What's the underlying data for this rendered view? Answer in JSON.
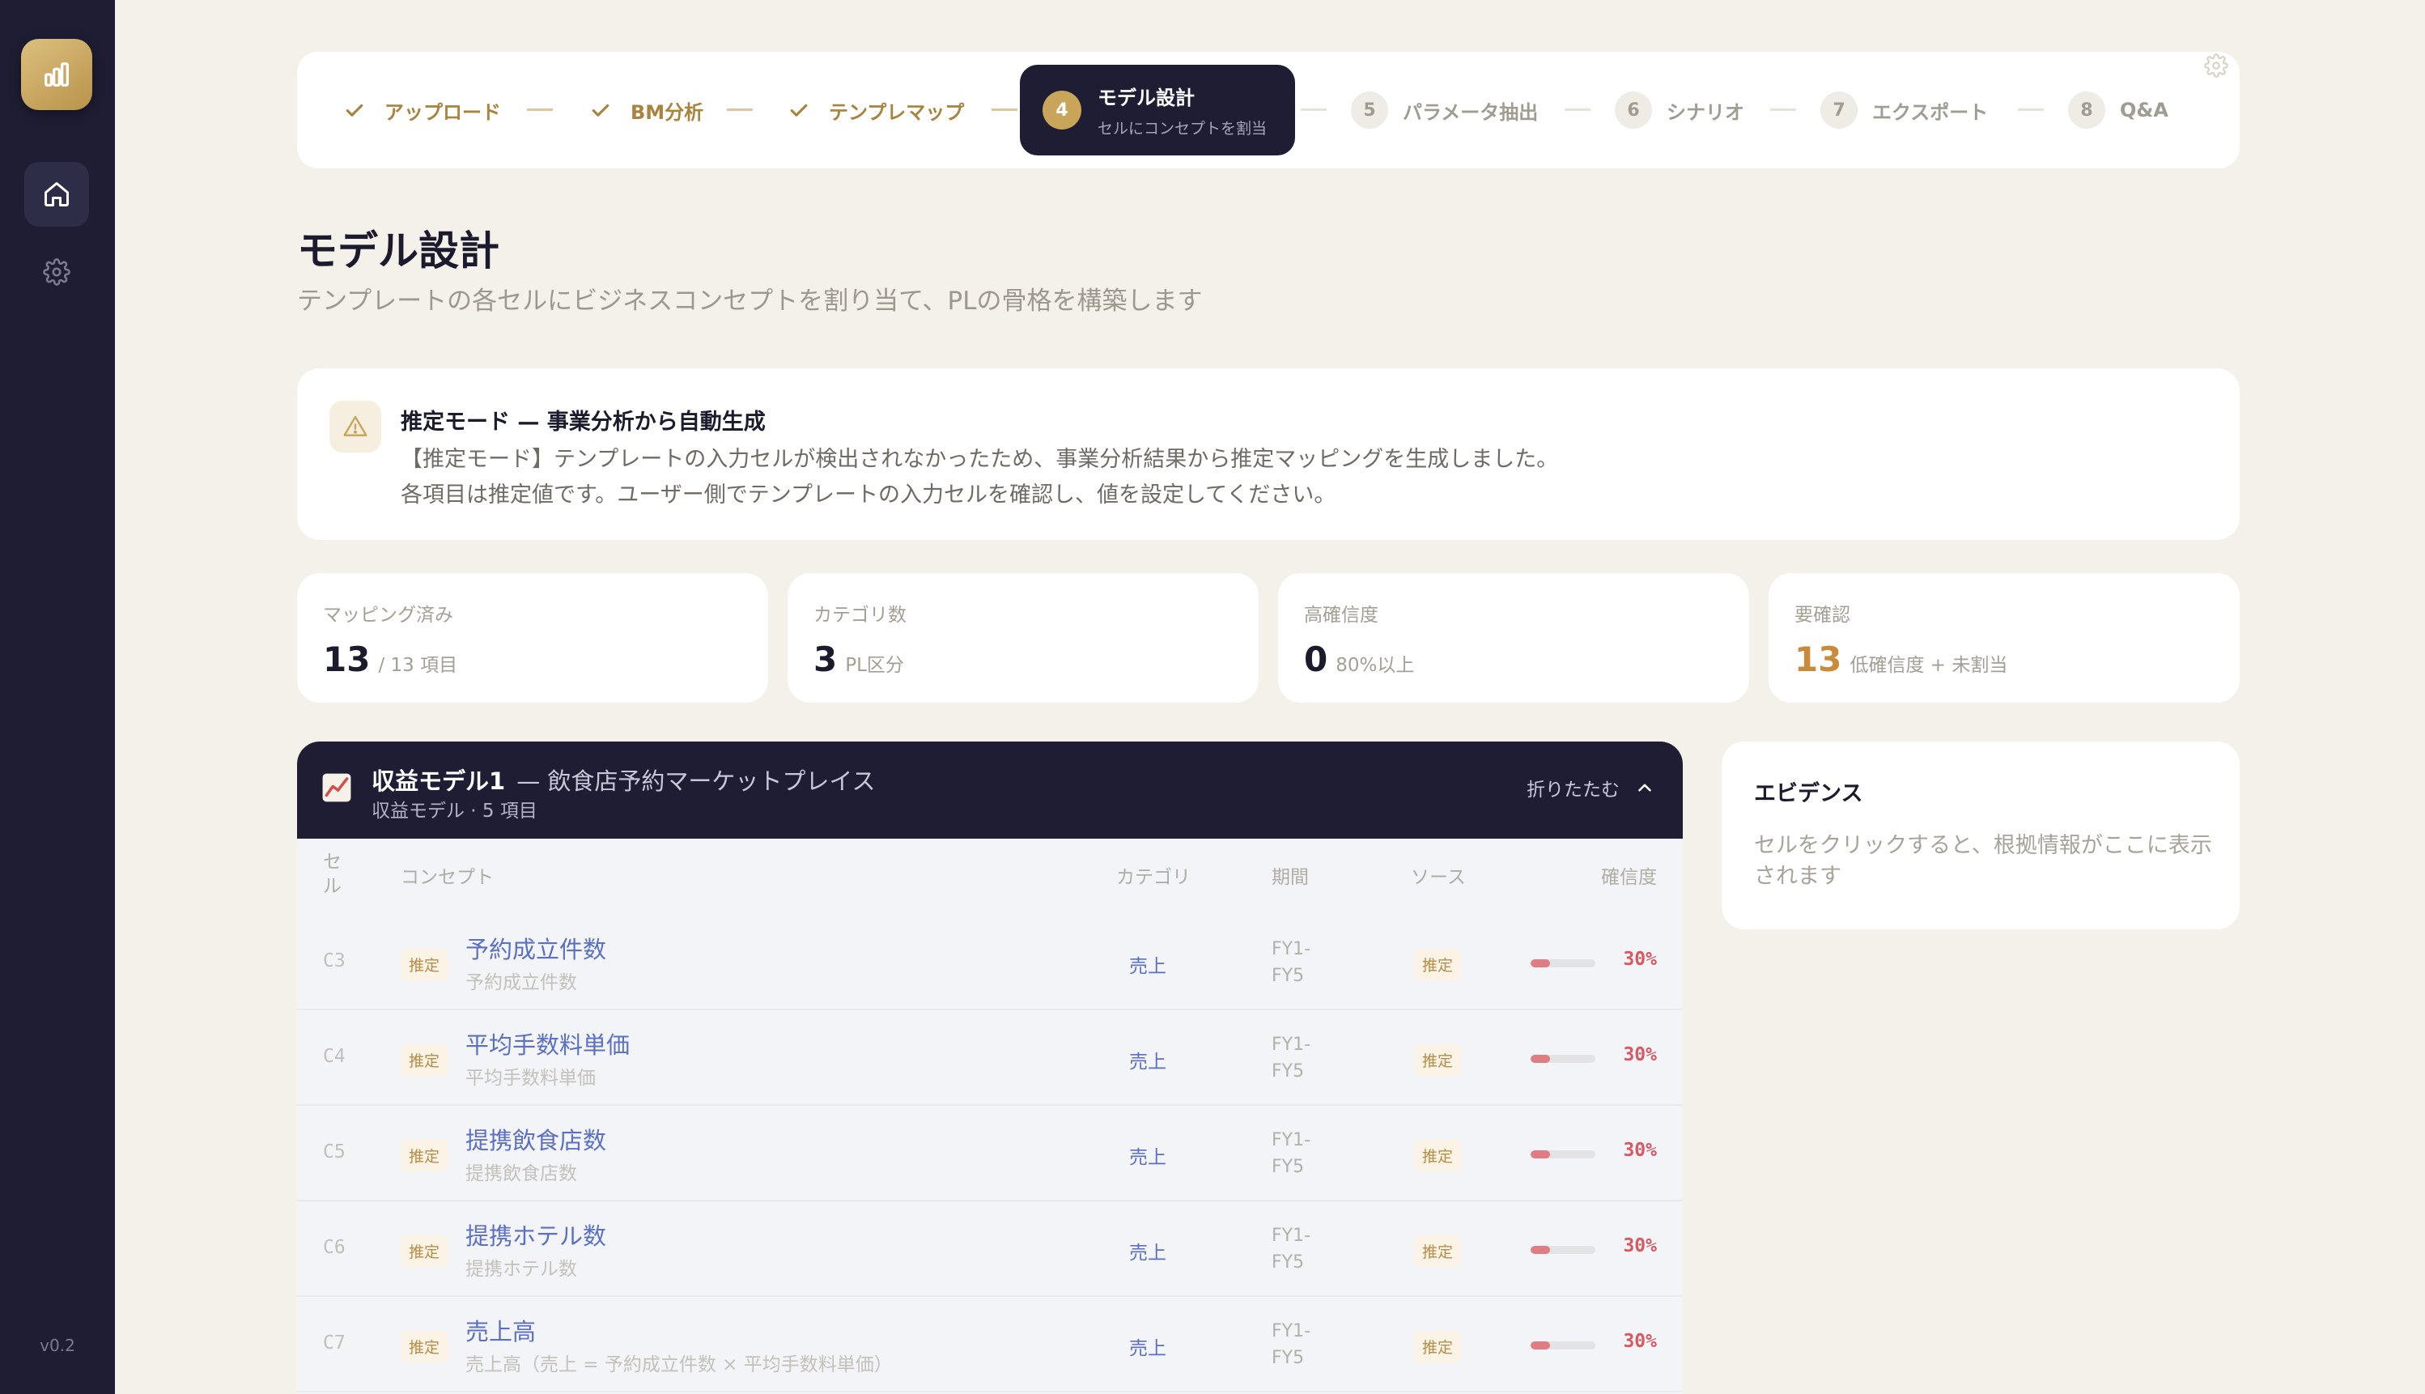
{
  "app": {
    "version": "v0.2"
  },
  "stepper": {
    "steps": [
      {
        "label": "アップロード",
        "status": "done"
      },
      {
        "label": "BM分析",
        "status": "done"
      },
      {
        "label": "テンプレマップ",
        "status": "done"
      },
      {
        "num": "4",
        "label": "モデル設計",
        "sub": "セルにコンセプトを割当",
        "status": "active"
      },
      {
        "num": "5",
        "label": "パラメータ抽出",
        "status": "todo"
      },
      {
        "num": "6",
        "label": "シナリオ",
        "status": "todo"
      },
      {
        "num": "7",
        "label": "エクスポート",
        "status": "todo"
      },
      {
        "num": "8",
        "label": "Q&A",
        "status": "todo"
      }
    ]
  },
  "page": {
    "title": "モデル設計",
    "subtitle": "テンプレートの各セルにビジネスコンセプトを割り当て、PLの骨格を構築します"
  },
  "notice": {
    "title": "推定モード — 事業分析から自動生成",
    "line1": "【推定モード】テンプレートの入力セルが検出されなかったため、事業分析結果から推定マッピングを生成しました。",
    "line2": "各項目は推定値です。ユーザー側でテンプレートの入力セルを確認し、値を設定してください。"
  },
  "stats": [
    {
      "label": "マッピング済み",
      "value": "13",
      "unit": "/ 13 項目",
      "color": "#1c1b2e"
    },
    {
      "label": "カテゴリ数",
      "value": "3",
      "unit": "PL区分",
      "color": "#1c1b2e"
    },
    {
      "label": "高確信度",
      "value": "0",
      "unit": "80%以上",
      "color": "#1c1b2e"
    },
    {
      "label": "要確認",
      "value": "13",
      "unit": "低確信度 + 未割当",
      "color": "#c98b3a"
    }
  ],
  "model": {
    "title": "収益モデル1",
    "subtitle": "— 飲食店予約マーケットプレイス",
    "meta": "収益モデル · 5 項目",
    "collapse_label": "折りたたむ",
    "headers": {
      "cell": "セル",
      "concept": "コンセプト",
      "category": "カテゴリ",
      "period": "期間",
      "source": "ソース",
      "confidence": "確信度"
    },
    "rows": [
      {
        "cell": "C3",
        "tag": "推定",
        "main": "予約成立件数",
        "sub": "予約成立件数",
        "category": "売上",
        "period1": "FY1-",
        "period2": "FY5",
        "source": "推定",
        "confidence": "30%",
        "conf_value": 0.3
      },
      {
        "cell": "C4",
        "tag": "推定",
        "main": "平均手数料単価",
        "sub": "平均手数料単価",
        "category": "売上",
        "period1": "FY1-",
        "period2": "FY5",
        "source": "推定",
        "confidence": "30%",
        "conf_value": 0.3
      },
      {
        "cell": "C5",
        "tag": "推定",
        "main": "提携飲食店数",
        "sub": "提携飲食店数",
        "category": "売上",
        "period1": "FY1-",
        "period2": "FY5",
        "source": "推定",
        "confidence": "30%",
        "conf_value": 0.3
      },
      {
        "cell": "C6",
        "tag": "推定",
        "main": "提携ホテル数",
        "sub": "提携ホテル数",
        "category": "売上",
        "period1": "FY1-",
        "period2": "FY5",
        "source": "推定",
        "confidence": "30%",
        "conf_value": 0.3
      },
      {
        "cell": "C7",
        "tag": "推定",
        "main": "売上高",
        "sub": "売上高（売上 = 予約成立件数 × 平均手数料単価）",
        "category": "売上",
        "period1": "FY1-",
        "period2": "FY5",
        "source": "推定",
        "confidence": "30%",
        "conf_value": 0.3
      }
    ]
  },
  "evidence": {
    "title": "エビデンス",
    "placeholder": "セルをクリックすると、根拠情報がここに表示されます"
  },
  "colors": {
    "accent": "#c9a55a",
    "dark": "#1e1d33",
    "link": "#5b70c4",
    "danger": "#d75a62"
  }
}
